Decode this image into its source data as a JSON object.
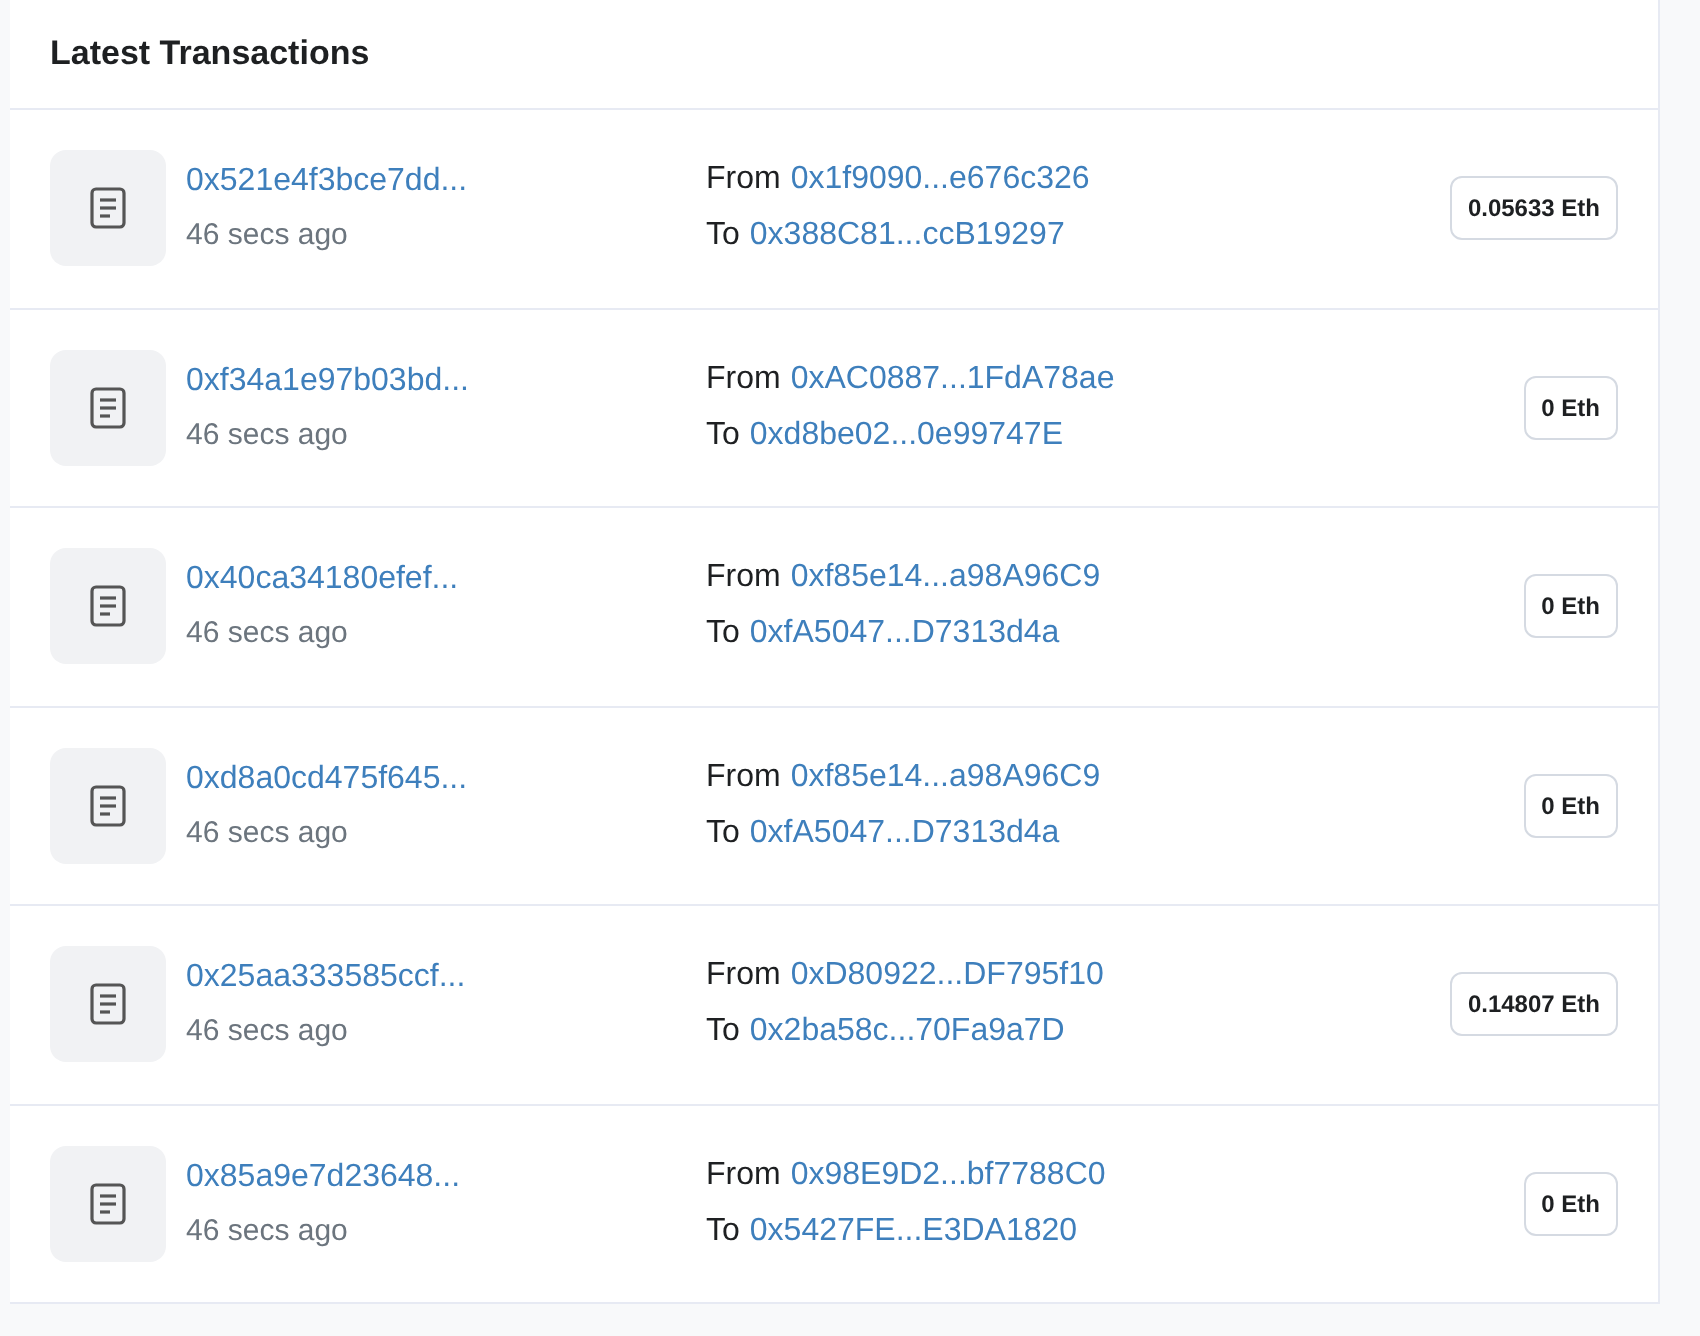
{
  "title": "Latest Transactions",
  "transactions": [
    {
      "hash": "0x521e4f3bce7dd...",
      "time": "46 secs ago",
      "from_label": "From",
      "from": "0x1f9090...e676c326",
      "to_label": "To",
      "to": "0x388C81...ccB19297",
      "amount": "0.05633 Eth"
    },
    {
      "hash": "0xf34a1e97b03bd...",
      "time": "46 secs ago",
      "from_label": "From",
      "from": "0xAC0887...1FdA78ae",
      "to_label": "To",
      "to": "0xd8be02...0e99747E",
      "amount": "0 Eth"
    },
    {
      "hash": "0x40ca34180efef...",
      "time": "46 secs ago",
      "from_label": "From",
      "from": "0xf85e14...a98A96C9",
      "to_label": "To",
      "to": "0xfA5047...D7313d4a",
      "amount": "0 Eth"
    },
    {
      "hash": "0xd8a0cd475f645...",
      "time": "46 secs ago",
      "from_label": "From",
      "from": "0xf85e14...a98A96C9",
      "to_label": "To",
      "to": "0xfA5047...D7313d4a",
      "amount": "0 Eth"
    },
    {
      "hash": "0x25aa333585ccf...",
      "time": "46 secs ago",
      "from_label": "From",
      "from": "0xD80922...DF795f10",
      "to_label": "To",
      "to": "0x2ba58c...70Fa9a7D",
      "amount": "0.14807 Eth"
    },
    {
      "hash": "0x85a9e7d23648...",
      "time": "46 secs ago",
      "from_label": "From",
      "from": "0x98E9D2...bf7788C0",
      "to_label": "To",
      "to": "0x5427FE...E3DA1820",
      "amount": "0 Eth"
    }
  ]
}
